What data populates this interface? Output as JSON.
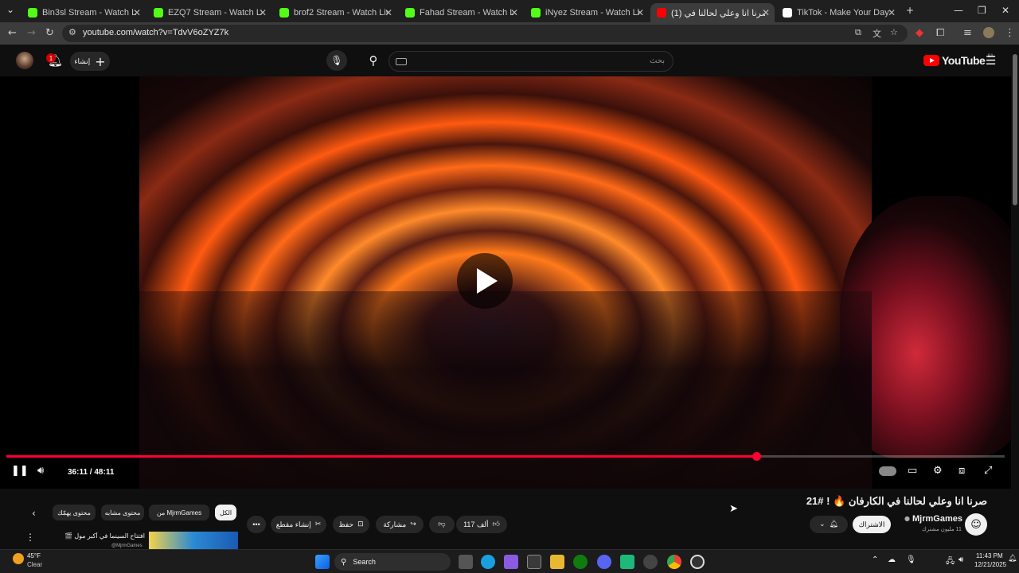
{
  "browser": {
    "tabs": [
      {
        "title": "Bin3sl Stream - Watch Live on K",
        "icon": "kick-icon",
        "color": "#53fc18",
        "active": false
      },
      {
        "title": "EZQ7 Stream - Watch Live on K",
        "icon": "kick-icon",
        "color": "#53fc18",
        "active": false
      },
      {
        "title": "brof2 Stream - Watch Live on K",
        "icon": "kick-icon",
        "color": "#53fc18",
        "active": false
      },
      {
        "title": "Fahad Stream - Watch Live on K",
        "icon": "kick-icon",
        "color": "#53fc18",
        "active": false
      },
      {
        "title": "iNyez Stream - Watch Live on K",
        "icon": "kick-icon",
        "color": "#53fc18",
        "active": false
      },
      {
        "title": "(1) صرنا انا وعلي لحالنا في",
        "icon": "youtube-icon",
        "color": "#ff0000",
        "active": true
      },
      {
        "title": "TikTok - Make Your Day",
        "icon": "tiktok-icon",
        "color": "#ffffff",
        "active": false
      }
    ],
    "url": "youtube.com/watch?v=TdvV6oZYZ7k"
  },
  "yt_header": {
    "create_label": "إنشاء",
    "notification_count": "1",
    "search_placeholder": "بحث",
    "logo_text": "YouTube",
    "region": "SA"
  },
  "player": {
    "time": "36:11 / 48:11",
    "progress": 0.751
  },
  "video": {
    "title": "صرنا انا وعلي لحالنا في الكارفان 🔥 ! #21",
    "channel_name": "MjrmGames",
    "subscribers": "11 مليون مشترك",
    "subscribed_label": "الاشتراك",
    "like_count": "117 ألف",
    "share_label": "مشاركة",
    "save_label": "حفظ",
    "clip_label": "إنشاء مقطع"
  },
  "chips": [
    "الكل",
    "من MjrmGames",
    "محتوى مشابه",
    "محتوى يهمّك"
  ],
  "recommended": {
    "title": "افتتاح السينما في أكبر مول 🎬",
    "channel": "@MjrmGames"
  },
  "taskbar": {
    "weather_temp": "45°F",
    "weather_desc": "Clear",
    "search_label": "Search",
    "time": "11:43 PM",
    "date": "12/21/2025"
  }
}
